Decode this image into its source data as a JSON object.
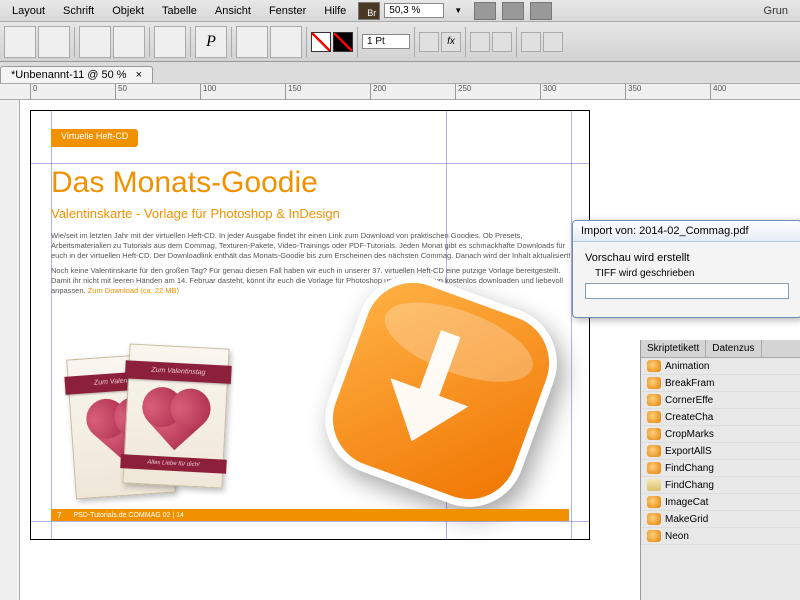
{
  "menu": {
    "items": [
      "Layout",
      "Schrift",
      "Objekt",
      "Tabelle",
      "Ansicht",
      "Fenster",
      "Hilfe"
    ],
    "zoom": "50,3 %",
    "right": "Grun"
  },
  "toolbar": {
    "stroke_value": "1 Pt"
  },
  "doctab": {
    "label": "*Unbenannt-11 @ 50 %"
  },
  "ruler": {
    "ticks": [
      "0",
      "50",
      "100",
      "150",
      "200",
      "250",
      "300",
      "350",
      "400"
    ]
  },
  "page": {
    "header_tag": "Virtuelle Heft-CD",
    "title": "Das Monats-Goodie",
    "subtitle": "Valentinskarte - Vorlage für Photoshop & InDesign",
    "para1": "Wie/seit im letzten Jahr mit der virtuellen Heft-CD. In jeder Ausgabe findet ihr einen Link zum Download von praktischen Goodies. Ob Presets, Arbeitsmaterialien zu Tutorials aus dem Commag, Texturen-Pakete, Video-Trainings oder PDF-Tutorials. Jeden Monat gibt es schmackhafte Downloads für euch in der virtuellen Heft-CD. Der Downloadlink enthält das Monats-Goodie bis zum Erscheinen des nächsten Commag. Danach wird der Inhalt aktualisiert!",
    "para2": "Noch keine Valentinskarte für den großen Tag? Für genau diesen Fall haben wir euch in unserer 37. virtuellen Heft-CD eine putzige Vorlage bereitgestellt. Damit ihr nicht mit leeren Händen am 14. Februar dasteht, könnt ihr euch die Vorlage für Photoshop und InDesign nun kostenlos downloaden und liebevoll anpassen.",
    "link": "Zum Download (ca. 22 MB)",
    "card_ribbon1": "Zum Valentin…",
    "card_ribbon2": "Zum Valentinstag",
    "card_footer": "Alles Liebe für dich!",
    "footer_num": "7",
    "footer_text": "PSD-Tutorials.de COMMAG 02 | 14"
  },
  "dialog": {
    "title": "Import von: 2014-02_Commag.pdf",
    "line1": "Vorschau wird erstellt",
    "line2": "TIFF wird geschrieben"
  },
  "panel": {
    "tabs": [
      "Skriptetikett",
      "Datenzus"
    ],
    "items": [
      "Animation",
      "BreakFram",
      "CornerEffe",
      "CreateCha",
      "CropMarks",
      "ExportAllS",
      "FindChang",
      "FindChang",
      "ImageCat",
      "MakeGrid",
      "Neon"
    ]
  }
}
